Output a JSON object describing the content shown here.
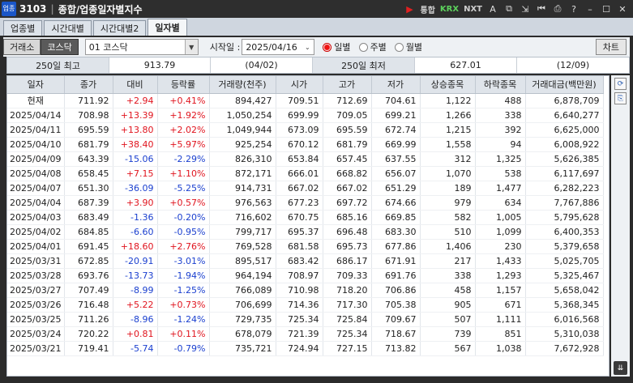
{
  "window": {
    "code": "3103",
    "title": "종합/업종일자별지수",
    "logo_text": "업종",
    "toolbar_texts": [
      "통합",
      "KRX",
      "NXT"
    ]
  },
  "tabs": [
    {
      "label": "업종별",
      "active": false
    },
    {
      "label": "시간대별",
      "active": false
    },
    {
      "label": "시간대별2",
      "active": false
    },
    {
      "label": "일자별",
      "active": true
    }
  ],
  "controls": {
    "market_buttons": [
      {
        "label": "거래소",
        "active": false
      },
      {
        "label": "코스닥",
        "active": true
      }
    ],
    "index_select": "01  코스닥",
    "start_label": "시작일 :",
    "start_date": "2025/04/16",
    "periods": [
      {
        "label": "일별",
        "selected": true
      },
      {
        "label": "주별",
        "selected": false
      },
      {
        "label": "월별",
        "selected": false
      }
    ],
    "chart_button": "차트"
  },
  "summary": {
    "high_label": "250일 최고",
    "high_value": "913.79",
    "high_date": "(04/02)",
    "low_label": "250일 최저",
    "low_value": "627.01",
    "low_date": "(12/09)"
  },
  "table": {
    "headers": [
      "일자",
      "종가",
      "대비",
      "등락률",
      "거래량(천주)",
      "시가",
      "고가",
      "저가",
      "상승종목",
      "하락종목",
      "거래대금(백만원)"
    ],
    "rows": [
      {
        "date": "현재",
        "close": "711.92",
        "change": "+2.94",
        "rate": "+0.41%",
        "volume": "894,427",
        "open": "709.51",
        "high": "712.69",
        "low": "704.61",
        "adv": "1,122",
        "dec": "488",
        "amount": "6,878,709",
        "dir": "up"
      },
      {
        "date": "2025/04/14",
        "close": "708.98",
        "change": "+13.39",
        "rate": "+1.92%",
        "volume": "1,050,254",
        "open": "699.99",
        "high": "709.05",
        "low": "699.21",
        "adv": "1,266",
        "dec": "338",
        "amount": "6,640,277",
        "dir": "up"
      },
      {
        "date": "2025/04/11",
        "close": "695.59",
        "change": "+13.80",
        "rate": "+2.02%",
        "volume": "1,049,944",
        "open": "673.09",
        "high": "695.59",
        "low": "672.74",
        "adv": "1,215",
        "dec": "392",
        "amount": "6,625,000",
        "dir": "up"
      },
      {
        "date": "2025/04/10",
        "close": "681.79",
        "change": "+38.40",
        "rate": "+5.97%",
        "volume": "925,254",
        "open": "670.12",
        "high": "681.79",
        "low": "669.99",
        "adv": "1,558",
        "dec": "94",
        "amount": "6,008,922",
        "dir": "up"
      },
      {
        "date": "2025/04/09",
        "close": "643.39",
        "change": "-15.06",
        "rate": "-2.29%",
        "volume": "826,310",
        "open": "653.84",
        "high": "657.45",
        "low": "637.55",
        "adv": "312",
        "dec": "1,325",
        "amount": "5,626,385",
        "dir": "dn"
      },
      {
        "date": "2025/04/08",
        "close": "658.45",
        "change": "+7.15",
        "rate": "+1.10%",
        "volume": "872,171",
        "open": "666.01",
        "high": "668.82",
        "low": "656.07",
        "adv": "1,070",
        "dec": "538",
        "amount": "6,117,697",
        "dir": "up"
      },
      {
        "date": "2025/04/07",
        "close": "651.30",
        "change": "-36.09",
        "rate": "-5.25%",
        "volume": "914,731",
        "open": "667.02",
        "high": "667.02",
        "low": "651.29",
        "adv": "189",
        "dec": "1,477",
        "amount": "6,282,223",
        "dir": "dn"
      },
      {
        "date": "2025/04/04",
        "close": "687.39",
        "change": "+3.90",
        "rate": "+0.57%",
        "volume": "976,563",
        "open": "677.23",
        "high": "697.72",
        "low": "674.66",
        "adv": "979",
        "dec": "634",
        "amount": "7,767,886",
        "dir": "up"
      },
      {
        "date": "2025/04/03",
        "close": "683.49",
        "change": "-1.36",
        "rate": "-0.20%",
        "volume": "716,602",
        "open": "670.75",
        "high": "685.16",
        "low": "669.85",
        "adv": "582",
        "dec": "1,005",
        "amount": "5,795,628",
        "dir": "dn"
      },
      {
        "date": "2025/04/02",
        "close": "684.85",
        "change": "-6.60",
        "rate": "-0.95%",
        "volume": "799,717",
        "open": "695.37",
        "high": "696.48",
        "low": "683.30",
        "adv": "510",
        "dec": "1,099",
        "amount": "6,400,353",
        "dir": "dn"
      },
      {
        "date": "2025/04/01",
        "close": "691.45",
        "change": "+18.60",
        "rate": "+2.76%",
        "volume": "769,528",
        "open": "681.58",
        "high": "695.73",
        "low": "677.86",
        "adv": "1,406",
        "dec": "230",
        "amount": "5,379,658",
        "dir": "up"
      },
      {
        "date": "2025/03/31",
        "close": "672.85",
        "change": "-20.91",
        "rate": "-3.01%",
        "volume": "895,517",
        "open": "683.42",
        "high": "686.17",
        "low": "671.91",
        "adv": "217",
        "dec": "1,433",
        "amount": "5,025,705",
        "dir": "dn"
      },
      {
        "date": "2025/03/28",
        "close": "693.76",
        "change": "-13.73",
        "rate": "-1.94%",
        "volume": "964,194",
        "open": "708.97",
        "high": "709.33",
        "low": "691.76",
        "adv": "338",
        "dec": "1,293",
        "amount": "5,325,467",
        "dir": "dn"
      },
      {
        "date": "2025/03/27",
        "close": "707.49",
        "change": "-8.99",
        "rate": "-1.25%",
        "volume": "766,089",
        "open": "710.98",
        "high": "718.20",
        "low": "706.86",
        "adv": "458",
        "dec": "1,157",
        "amount": "5,658,042",
        "dir": "dn"
      },
      {
        "date": "2025/03/26",
        "close": "716.48",
        "change": "+5.22",
        "rate": "+0.73%",
        "volume": "706,699",
        "open": "714.36",
        "high": "717.30",
        "low": "705.38",
        "adv": "905",
        "dec": "671",
        "amount": "5,368,345",
        "dir": "up"
      },
      {
        "date": "2025/03/25",
        "close": "711.26",
        "change": "-8.96",
        "rate": "-1.24%",
        "volume": "729,735",
        "open": "725.34",
        "high": "725.84",
        "low": "709.67",
        "adv": "507",
        "dec": "1,111",
        "amount": "6,016,568",
        "dir": "dn"
      },
      {
        "date": "2025/03/24",
        "close": "720.22",
        "change": "+0.81",
        "rate": "+0.11%",
        "volume": "678,079",
        "open": "721.39",
        "high": "725.34",
        "low": "718.67",
        "adv": "739",
        "dec": "851",
        "amount": "5,310,038",
        "dir": "up"
      },
      {
        "date": "2025/03/21",
        "close": "719.41",
        "change": "-5.74",
        "rate": "-0.79%",
        "volume": "735,721",
        "open": "724.94",
        "high": "727.15",
        "low": "713.82",
        "adv": "567",
        "dec": "1,038",
        "amount": "7,672,928",
        "dir": "dn"
      }
    ]
  },
  "colors": {
    "up": "#e0141e",
    "down": "#1a3fcf",
    "header_bg": "#dfe4ea",
    "titlebar_bg": "#2e2e2e"
  }
}
